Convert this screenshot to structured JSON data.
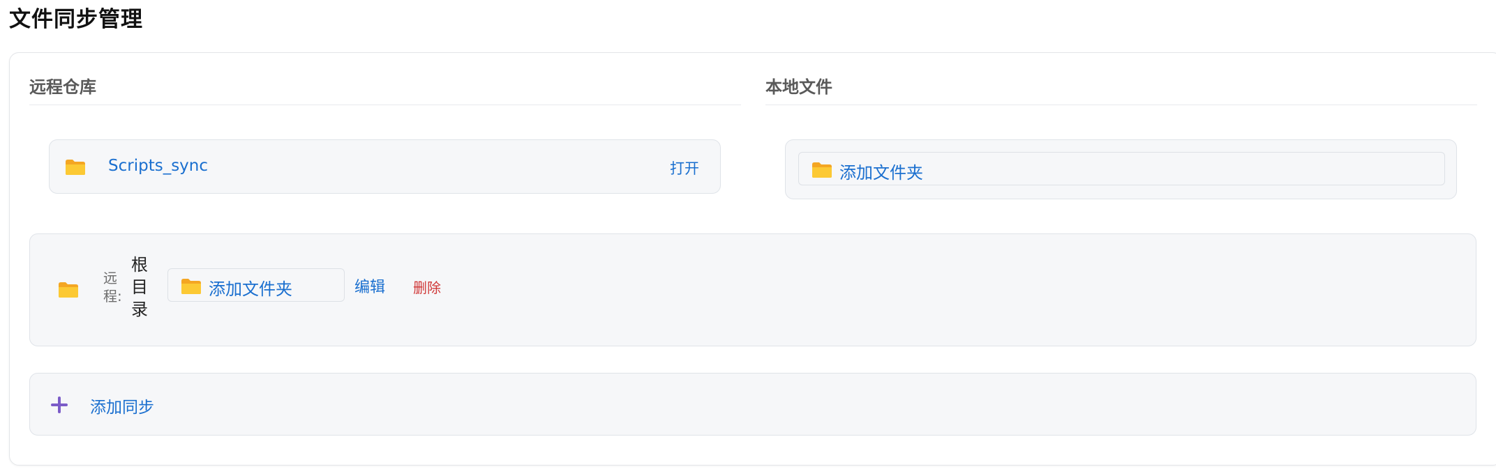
{
  "page": {
    "title": "文件同步管理"
  },
  "remote": {
    "heading": "远程仓库",
    "repo": {
      "name": "Scripts_sync",
      "open_label": "打开"
    }
  },
  "local": {
    "heading": "本地文件",
    "add_folder_label": "添加文件夹"
  },
  "sync_item": {
    "remote_label": "远程:",
    "remote_value": "根目录",
    "add_folder_label": "添加文件夹",
    "edit_label": "编辑",
    "delete_label": "删除"
  },
  "add_sync": {
    "label": "添加同步"
  },
  "colors": {
    "link": "#1a6fcf",
    "danger": "#d03838",
    "accent": "#7b5cc8",
    "folder": "#f7b928",
    "panel_bg": "#f6f7f9"
  },
  "icons": {
    "folder": "folder-icon",
    "plus": "plus-icon"
  }
}
